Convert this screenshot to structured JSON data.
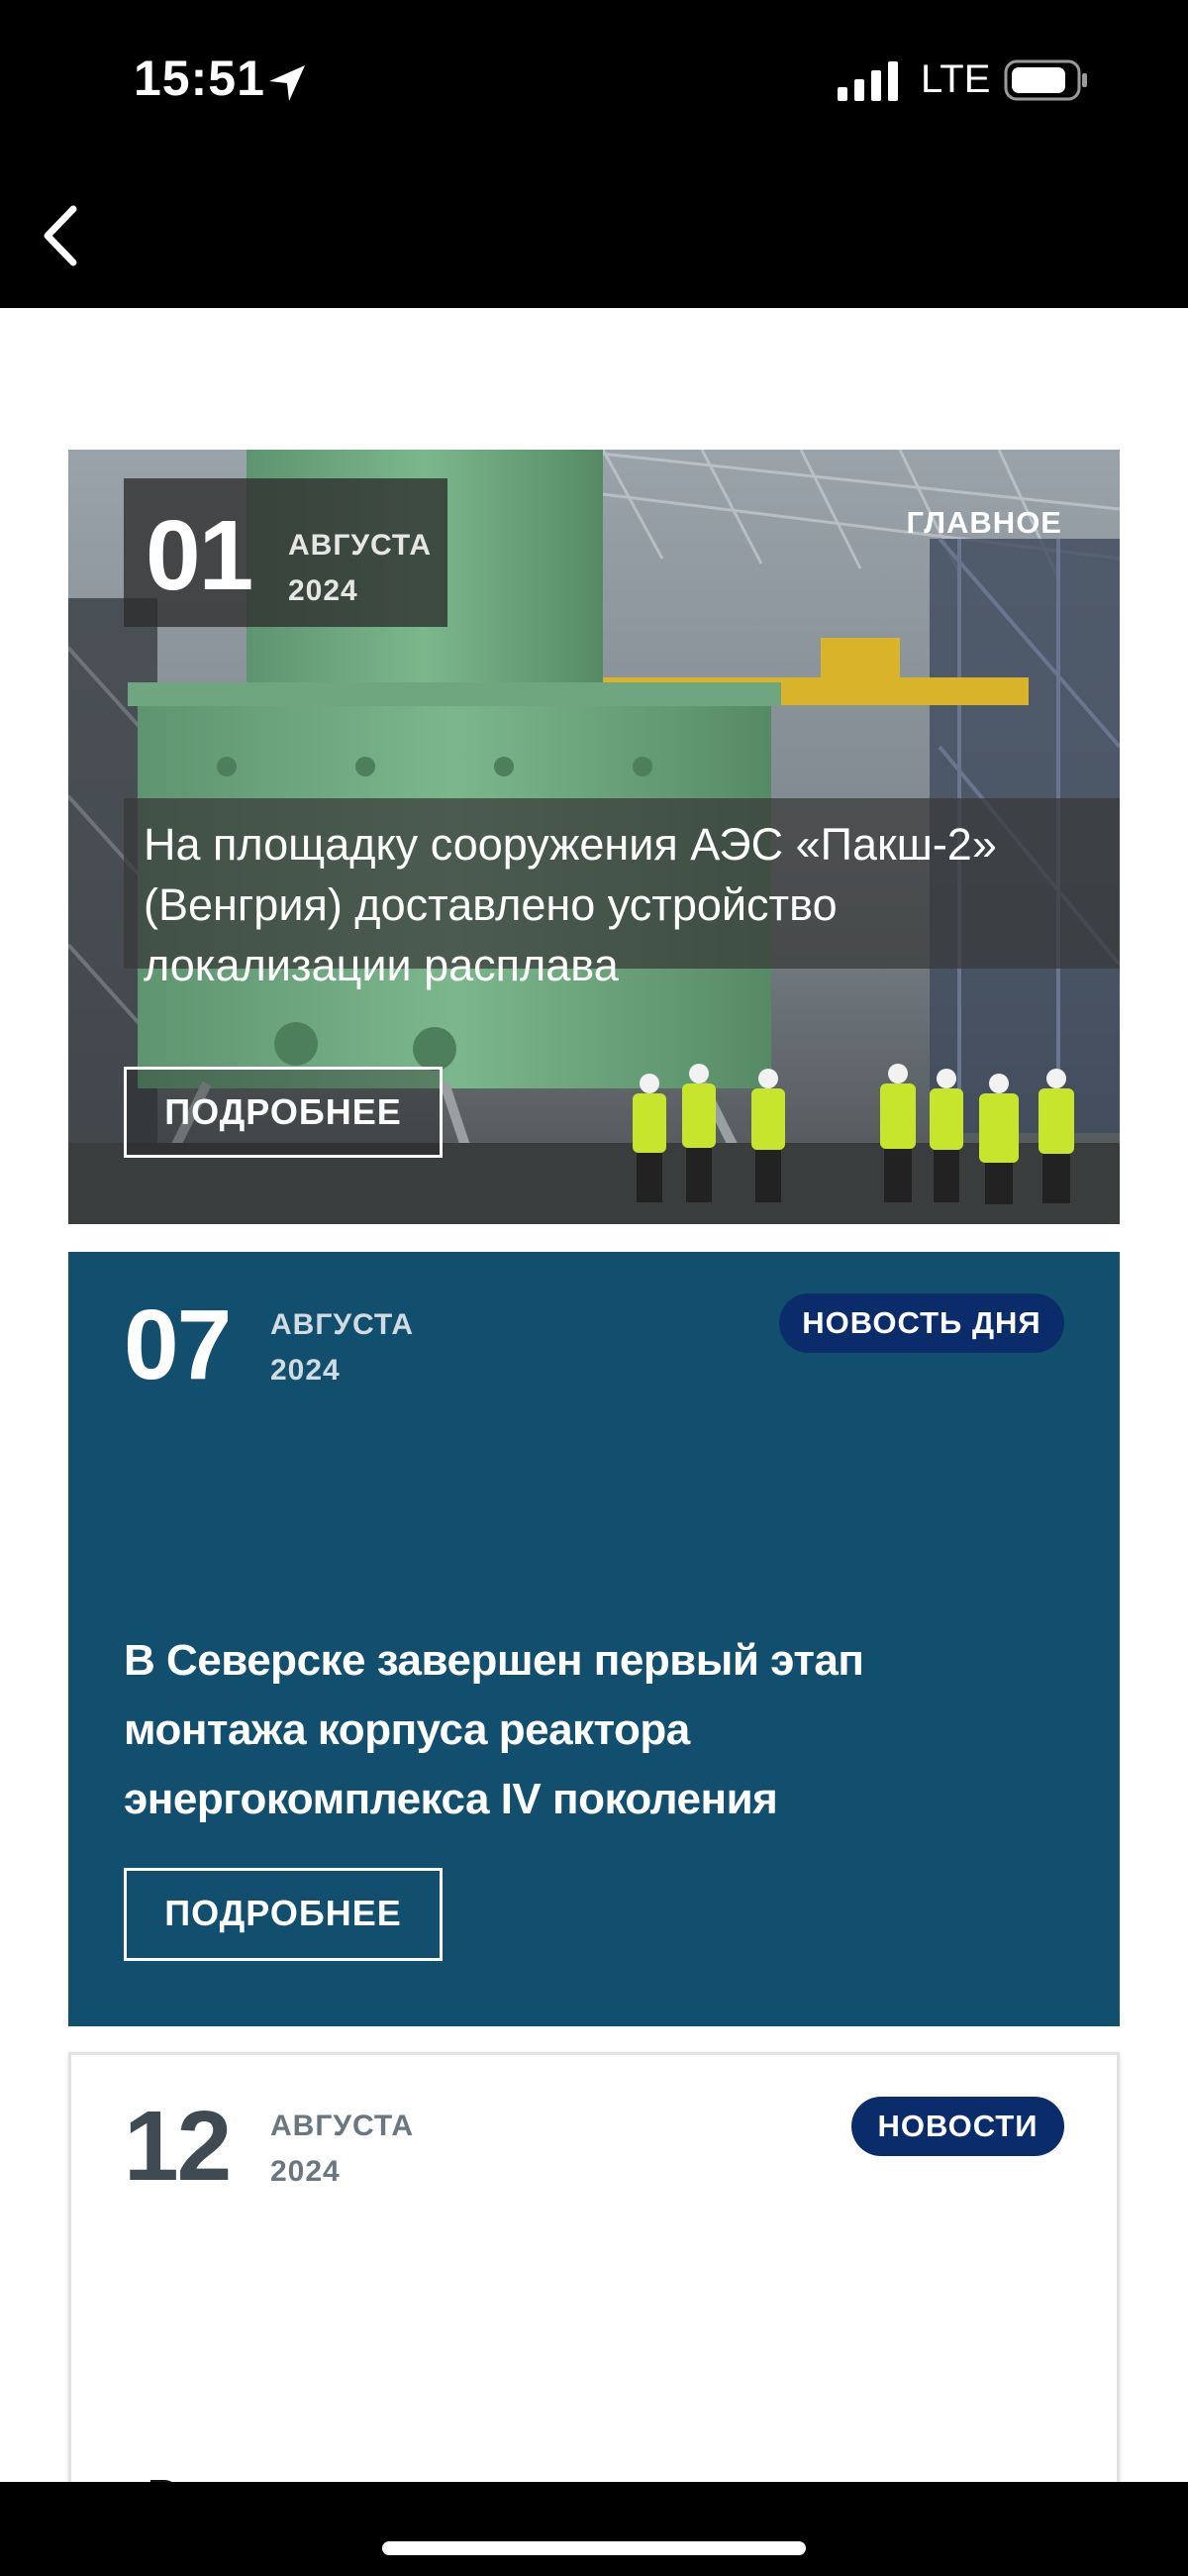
{
  "status_bar": {
    "time": "15:51",
    "network": "LTE"
  },
  "nav": {
    "back_icon": "chevron-left-icon"
  },
  "cards": [
    {
      "day": "01",
      "month": "АВГУСТА",
      "year": "2024",
      "tag": "ГЛАВНОЕ",
      "title": "На площадку сооружения АЭС «Пакш-2» (Венгрия) доставлено устройство локализации расплава",
      "button": "ПОДРОБНЕЕ"
    },
    {
      "day": "07",
      "month": "АВГУСТА",
      "year": "2024",
      "tag": "НОВОСТЬ ДНЯ",
      "title": "В Северске завершен первый этап монтажа корпуса реактора энергокомплекса IV поколения",
      "button": "ПОДРОБНЕЕ"
    },
    {
      "day": "12",
      "month": "АВГУСТА",
      "year": "2024",
      "tag": "НОВОСТИ",
      "title": "«Росатом» представил видение"
    }
  ],
  "colors": {
    "day_card_bg": "#124e6d",
    "pill_bg": "#0b2c6b",
    "status_bar_bg": "#000000"
  }
}
